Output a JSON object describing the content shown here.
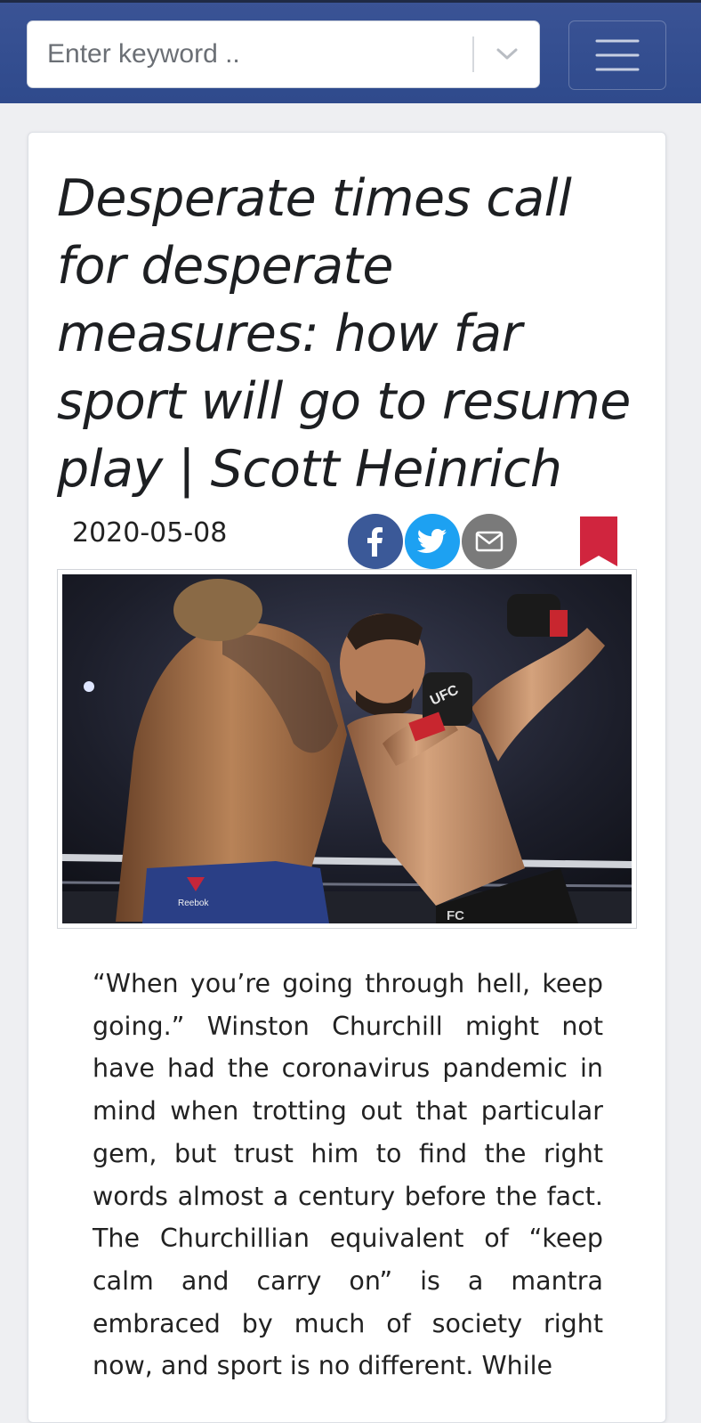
{
  "header": {
    "search": {
      "placeholder": "Enter keyword .."
    },
    "icons": {
      "dropdown": "chevron-down-icon",
      "menu": "hamburger-menu-icon"
    },
    "colors": {
      "bar": "#3a5395"
    }
  },
  "article": {
    "title": "Desperate times call for desperate measures: how far sport will go to resume play | Scott Heinrich",
    "date": "2020-05-08",
    "share": [
      {
        "icon": "facebook-icon",
        "color": "#3b5998"
      },
      {
        "icon": "twitter-icon",
        "color": "#1da1f2"
      },
      {
        "icon": "email-icon",
        "color": "#7a7a7a"
      }
    ],
    "bookmark_color": "#d0253e",
    "image": {
      "depicts": "mma-fighters-photo",
      "visible_text": [
        "UFC",
        "Reebok",
        "FC"
      ]
    },
    "body": "“When you’re going through hell, keep going.” Winston Churchill might not have had the coronavirus pandemic in mind when trotting out that particular gem, but trust him to find the right words almost a century before the fact. The Churchillian equivalent of “keep calm and carry on” is a mantra embraced by much of society right now, and sport is no different. While"
  }
}
